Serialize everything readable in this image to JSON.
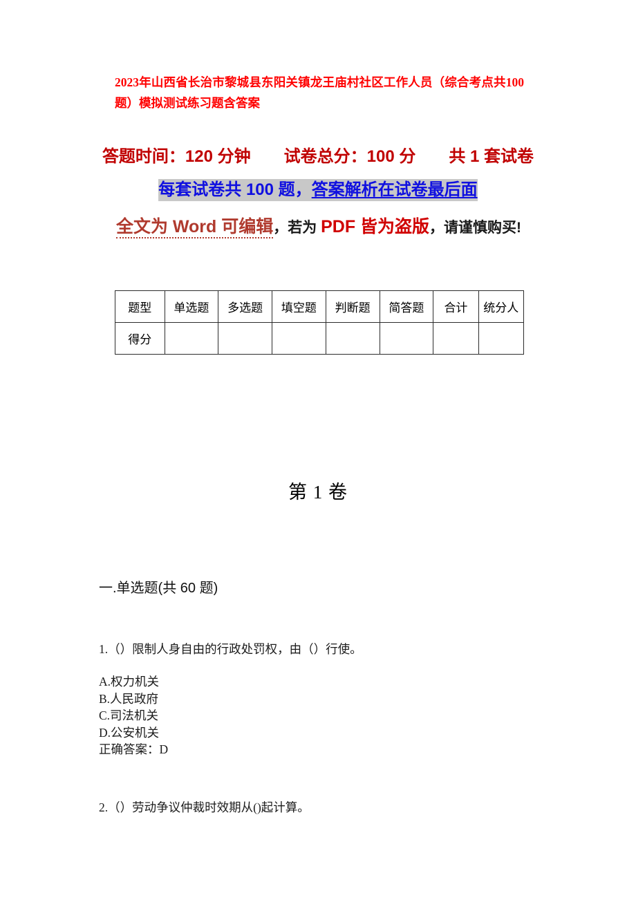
{
  "document": {
    "title": "2023年山西省长治市黎城县东阳关镇龙王庙村社区工作人员（综合考点共100题）模拟测试练习题含答案",
    "subtitle_line1": "答题时间：120 分钟　　试卷总分：100 分　　共 1 套试卷",
    "subtitle_line2_highlight": "每套试卷共 100 题，",
    "subtitle_line2_underline": "答案解析在试卷最后面",
    "notice": {
      "word_part": "全文为 Word 可编辑",
      "mid_part": "，若为 ",
      "pdf_part": "PDF 皆为盗版",
      "tail_part": "，请谨慎购买!"
    },
    "volume_heading": "第 1 卷"
  },
  "score_table": {
    "headers": [
      "题型",
      "单选题",
      "多选题",
      "填空题",
      "判断题",
      "简答题",
      "合计",
      "统分人"
    ],
    "rows": [
      {
        "label": "得分",
        "cells": [
          "",
          "",
          "",
          "",
          "",
          "",
          ""
        ]
      }
    ]
  },
  "content": {
    "section_heading": "一.单选题(共 60 题)",
    "questions": [
      {
        "stem": "1.（）限制人身自由的行政处罚权，由（）行使。",
        "options": [
          "A.权力机关",
          "B.人民政府",
          "C.司法机关",
          "D.公安机关"
        ],
        "answer": "正确答案：D"
      },
      {
        "stem": "2.（）劳动争议仲裁时效期从()起计算。",
        "options": [],
        "answer": ""
      }
    ]
  },
  "colors": {
    "title_red": "#FF0000",
    "subtitle_dark_red": "#C00000",
    "highlight_blue": "#1010E0",
    "highlight_bg": "#C8C8C8",
    "word_brick_red": "#B03A2E",
    "pdf_red": "#D00000",
    "body_text": "#1c1c1c",
    "table_border": "#2b2b2b"
  }
}
